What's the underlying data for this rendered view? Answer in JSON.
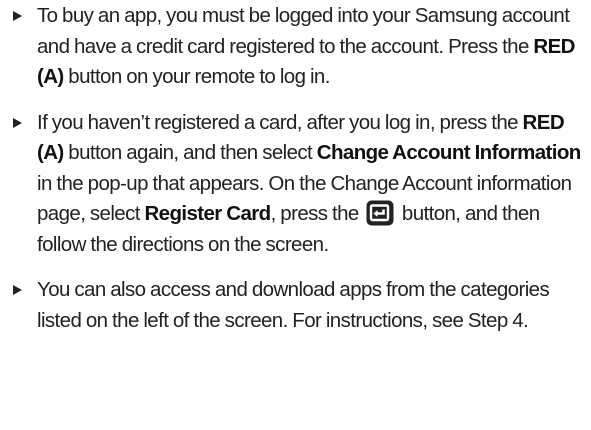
{
  "items": [
    {
      "icon": "bullet-triangle-icon",
      "segments": [
        "To buy an app, you must be logged into your Samsung account and have a credit card registered to the account. Press the ",
        "RED (A)",
        " button on your remote to log in."
      ]
    },
    {
      "icon": "bullet-triangle-icon",
      "segments": [
        "If you haven’t registered a card, after you log in, press the ",
        "RED (A)",
        " button again, and then select ",
        "Change Account Information",
        " in the pop-up that appears. On the Change Account information page, select ",
        "Register Card",
        ", press the ",
        " button, and then follow the directions on the screen."
      ],
      "inline_icon": "enter-button-icon"
    },
    {
      "icon": "bullet-triangle-icon",
      "segments": [
        "You can also access and download apps from the categories listed on the left of the screen. For instructions, see Step 4."
      ]
    }
  ],
  "colors": {
    "text": "#222222",
    "icon_fill": "#222222"
  }
}
